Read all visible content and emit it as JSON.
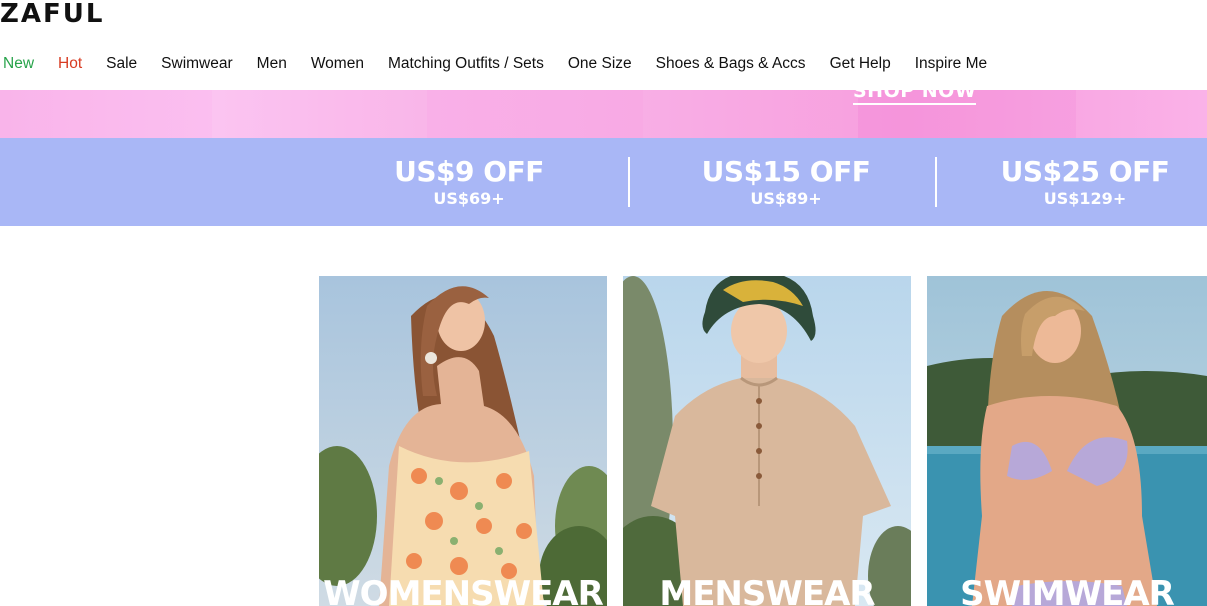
{
  "header": {
    "logo": "ZAFUL",
    "nav": [
      {
        "label": "New",
        "color": "#27a34a"
      },
      {
        "label": "Hot",
        "color": "#d83b22"
      },
      {
        "label": "Sale"
      },
      {
        "label": "Swimwear"
      },
      {
        "label": "Men"
      },
      {
        "label": "Women"
      },
      {
        "label": "Matching Outfits / Sets"
      },
      {
        "label": "One Size"
      },
      {
        "label": "Shoes & Bags & Accs"
      },
      {
        "label": "Get Help"
      },
      {
        "label": "Inspire Me"
      }
    ]
  },
  "banner": {
    "cta": "SHOP NOW",
    "background": "#f8a9e4"
  },
  "discounts": {
    "background": "#a9b7f6",
    "deals": [
      {
        "off": "US$9 OFF",
        "min": "US$69+"
      },
      {
        "off": "US$15 OFF",
        "min": "US$89+"
      },
      {
        "off": "US$25 OFF",
        "min": "US$129+"
      }
    ]
  },
  "categories": [
    {
      "label": "WOMENSWEAR"
    },
    {
      "label": "MENSWEAR"
    },
    {
      "label": "SWIMWEAR"
    }
  ]
}
